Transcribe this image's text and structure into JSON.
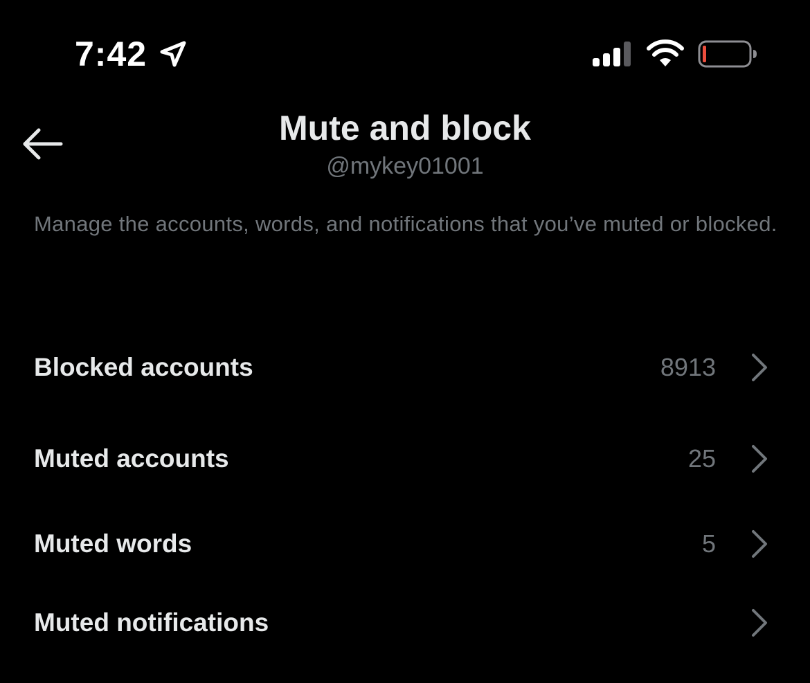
{
  "status_bar": {
    "time": "7:42",
    "icons": [
      "location-arrow-icon",
      "cellular-signal-icon",
      "wifi-icon",
      "battery-low-icon"
    ],
    "battery_level": 0.08,
    "battery_color": "#eb4e3d"
  },
  "header": {
    "back_icon": "arrow-left-icon",
    "title": "Mute and block",
    "subtitle": "@mykey01001"
  },
  "description": "Manage the accounts, words, and notifications that you’ve muted or blocked.",
  "settings": {
    "items": [
      {
        "label": "Blocked accounts",
        "count": "8913",
        "icon": "chevron-right-icon"
      },
      {
        "label": "Muted accounts",
        "count": "25",
        "icon": "chevron-right-icon"
      },
      {
        "label": "Muted words",
        "count": "5",
        "icon": "chevron-right-icon"
      },
      {
        "label": "Muted notifications",
        "count": "",
        "icon": "chevron-right-icon"
      }
    ]
  },
  "colors": {
    "background": "#000000",
    "primary_text": "#e7e9ea",
    "secondary_text": "#71767b",
    "battery_low": "#eb4e3d"
  }
}
